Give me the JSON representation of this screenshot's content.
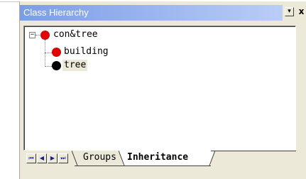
{
  "panel": {
    "title": "Class Hierarchy",
    "dropdown_glyph": "▾",
    "close_glyph": "x"
  },
  "tree": {
    "root": {
      "label": "con&tree",
      "expander": "−",
      "icon_color": "#e00000",
      "children": [
        {
          "label": "building",
          "icon_color": "#e00000",
          "selected": false
        },
        {
          "label": "tree",
          "icon_color": "#000000",
          "selected": true
        }
      ]
    }
  },
  "tabs": {
    "nav": [
      "⏮",
      "◀",
      "▶",
      "⏭"
    ],
    "items": [
      {
        "label": "Groups",
        "active": false
      },
      {
        "label": "Inheritance",
        "active": true
      }
    ]
  }
}
